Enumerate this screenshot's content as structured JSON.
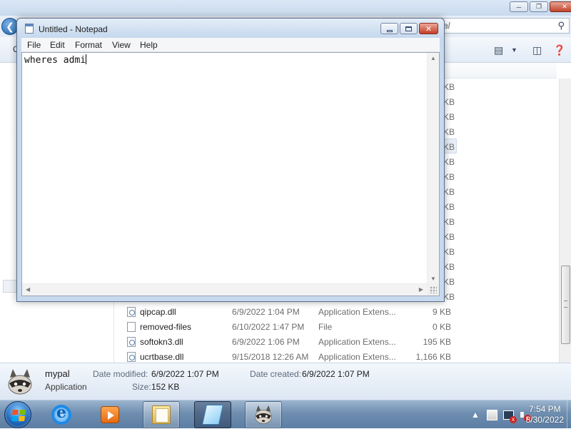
{
  "explorer": {
    "search_placeholder": "al",
    "toolbar_letter": "O",
    "files": [
      {
        "name": "qipcap.dll",
        "date": "6/9/2022 1:04 PM",
        "type": "Application Extens...",
        "size": "9 KB",
        "icon": "dll-icon"
      },
      {
        "name": "removed-files",
        "date": "6/10/2022 1:47 PM",
        "type": "File",
        "size": "0 KB",
        "icon": "file-icon"
      },
      {
        "name": "softokn3.dll",
        "date": "6/9/2022 1:06 PM",
        "type": "Application Extens...",
        "size": "195 KB",
        "icon": "dll-icon"
      },
      {
        "name": "ucrtbase.dll",
        "date": "9/15/2018 12:26 AM",
        "type": "Application Extens...",
        "size": "1,166 KB",
        "icon": "dll-icon"
      }
    ],
    "partial_size_suffix": "KB",
    "details": {
      "name": "mypal",
      "type": "Application",
      "date_modified_label": "Date modified:",
      "date_modified": "6/9/2022 1:07 PM",
      "date_created_label": "Date created:",
      "date_created": "6/9/2022 1:07 PM",
      "size_label": "Size:",
      "size": "152 KB"
    }
  },
  "notepad": {
    "title": "Untitled - Notepad",
    "menu": [
      "File",
      "Edit",
      "Format",
      "View",
      "Help"
    ],
    "content": "wheres admi"
  },
  "taskbar": {
    "pinned": [
      "start-orb",
      "internet-explorer-icon",
      "media-player-icon",
      "file-explorer-icon",
      "notepad-icon",
      "mypal-raccoon-icon"
    ],
    "clock_time": "7:54 PM",
    "clock_date": "8/30/2022"
  },
  "colors": {
    "taskbar": "#6f8eb0",
    "title_bar": "#c6d8ed",
    "close_button": "#c23d25"
  }
}
